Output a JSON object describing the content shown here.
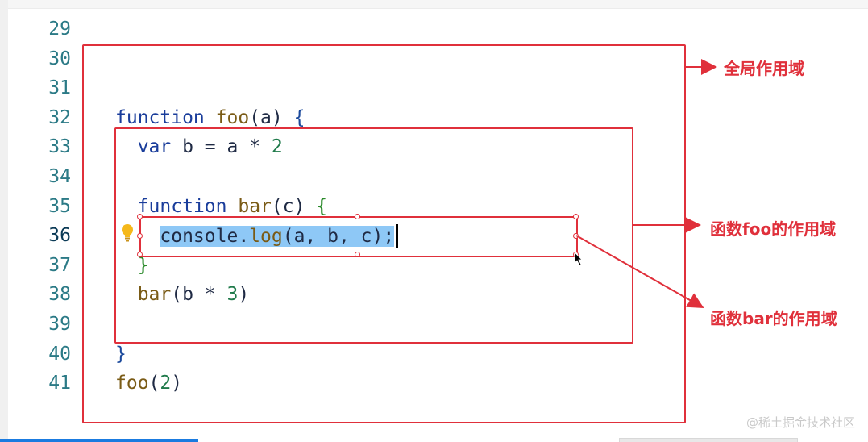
{
  "editor": {
    "line_numbers": [
      "29",
      "30",
      "31",
      "32",
      "33",
      "34",
      "35",
      "36",
      "37",
      "38",
      "39",
      "40",
      "41"
    ],
    "current_line": "36",
    "code_lines": [
      {
        "n": "29",
        "tokens": []
      },
      {
        "n": "30",
        "tokens": []
      },
      {
        "n": "31",
        "tokens": []
      },
      {
        "n": "32",
        "tokens": [
          {
            "t": "function",
            "c": "kw"
          },
          {
            "t": " "
          },
          {
            "t": "foo",
            "c": "fn"
          },
          {
            "t": "(a) "
          },
          {
            "t": "{",
            "c": "br"
          }
        ]
      },
      {
        "n": "33",
        "tokens": [
          {
            "t": "  "
          },
          {
            "t": "var",
            "c": "kw"
          },
          {
            "t": " b = a * "
          },
          {
            "t": "2",
            "c": "num"
          }
        ]
      },
      {
        "n": "34",
        "tokens": []
      },
      {
        "n": "35",
        "tokens": [
          {
            "t": "  "
          },
          {
            "t": "function",
            "c": "kw"
          },
          {
            "t": " "
          },
          {
            "t": "bar",
            "c": "fn"
          },
          {
            "t": "(c) "
          },
          {
            "t": "{",
            "c": "br2"
          }
        ]
      },
      {
        "n": "36",
        "tokens": [
          {
            "t": "    "
          },
          {
            "t": "console.",
            "c": "sel"
          },
          {
            "t": "log",
            "c": "fn sel"
          },
          {
            "t": "(a, b, c);",
            "c": "sel"
          }
        ]
      },
      {
        "n": "37",
        "tokens": [
          {
            "t": "  "
          },
          {
            "t": "}",
            "c": "br2"
          }
        ]
      },
      {
        "n": "38",
        "tokens": [
          {
            "t": "  "
          },
          {
            "t": "bar",
            "c": "fn"
          },
          {
            "t": "(b * "
          },
          {
            "t": "3",
            "c": "num"
          },
          {
            "t": ")"
          }
        ]
      },
      {
        "n": "39",
        "tokens": []
      },
      {
        "n": "40",
        "tokens": [
          {
            "t": "}",
            "c": "br"
          }
        ]
      },
      {
        "n": "41",
        "tokens": [
          {
            "t": "foo",
            "c": "fn"
          },
          {
            "t": "("
          },
          {
            "t": "2",
            "c": "num"
          },
          {
            "t": ")"
          }
        ]
      }
    ]
  },
  "annotations": {
    "global_scope": "全局作用域",
    "foo_scope": "函数foo的作用域",
    "bar_scope": "函数bar的作用域"
  },
  "watermark": "@稀土掘金技术社区",
  "colors": {
    "annotation_red": "#e0303b",
    "selection": "#8ec8f6",
    "line_number": "#2b7a86",
    "keyword": "#1a3d9b"
  },
  "icons": [
    "lightbulb-icon"
  ]
}
